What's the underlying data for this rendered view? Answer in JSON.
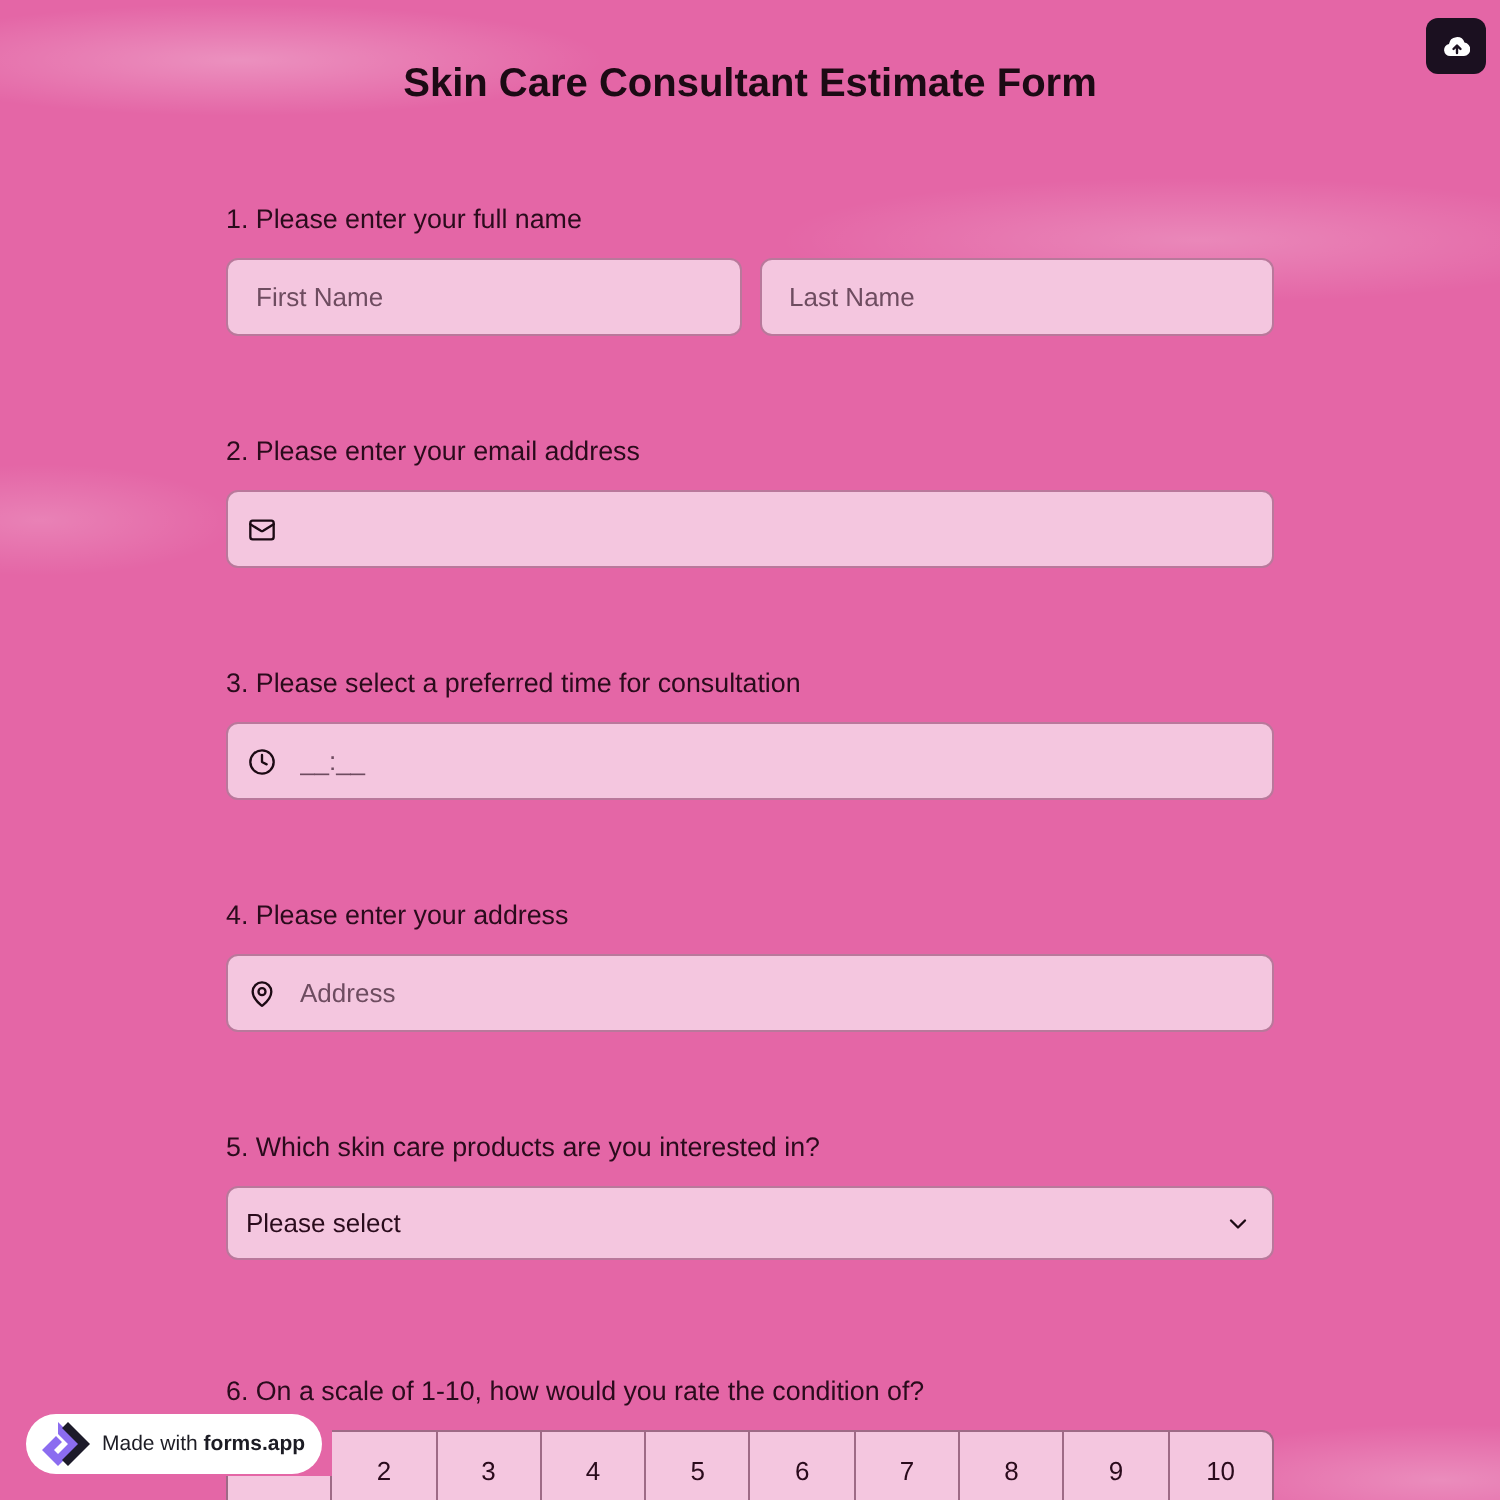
{
  "title": "Skin Care Consultant Estimate Form",
  "questions": [
    {
      "kind": "name",
      "label": "1. Please enter your full name",
      "fields": [
        {
          "placeholder": "First Name"
        },
        {
          "placeholder": "Last Name"
        }
      ]
    },
    {
      "kind": "email",
      "label": "2. Please enter your email address"
    },
    {
      "kind": "time",
      "label": "3. Please select a preferred time for consultation",
      "placeholder": "__:__"
    },
    {
      "kind": "address",
      "label": "4. Please enter your address",
      "placeholder": "Address"
    },
    {
      "kind": "select",
      "label": "5. Which skin care products are you interested in?",
      "value": "Please select"
    },
    {
      "kind": "scale",
      "label": "6. On a scale of 1-10, how would you rate the condition of?",
      "options": [
        {
          "kind": "covered"
        },
        {
          "kind": "number",
          "label": "2"
        },
        {
          "kind": "number",
          "label": "3"
        },
        {
          "kind": "number",
          "label": "4"
        },
        {
          "kind": "number",
          "label": "5"
        },
        {
          "kind": "number",
          "label": "6"
        },
        {
          "kind": "number",
          "label": "7"
        },
        {
          "kind": "number",
          "label": "8"
        },
        {
          "kind": "number",
          "label": "9"
        },
        {
          "kind": "number",
          "label": "10"
        }
      ]
    }
  ],
  "badge": {
    "text": "Made with **forms.app**"
  }
}
